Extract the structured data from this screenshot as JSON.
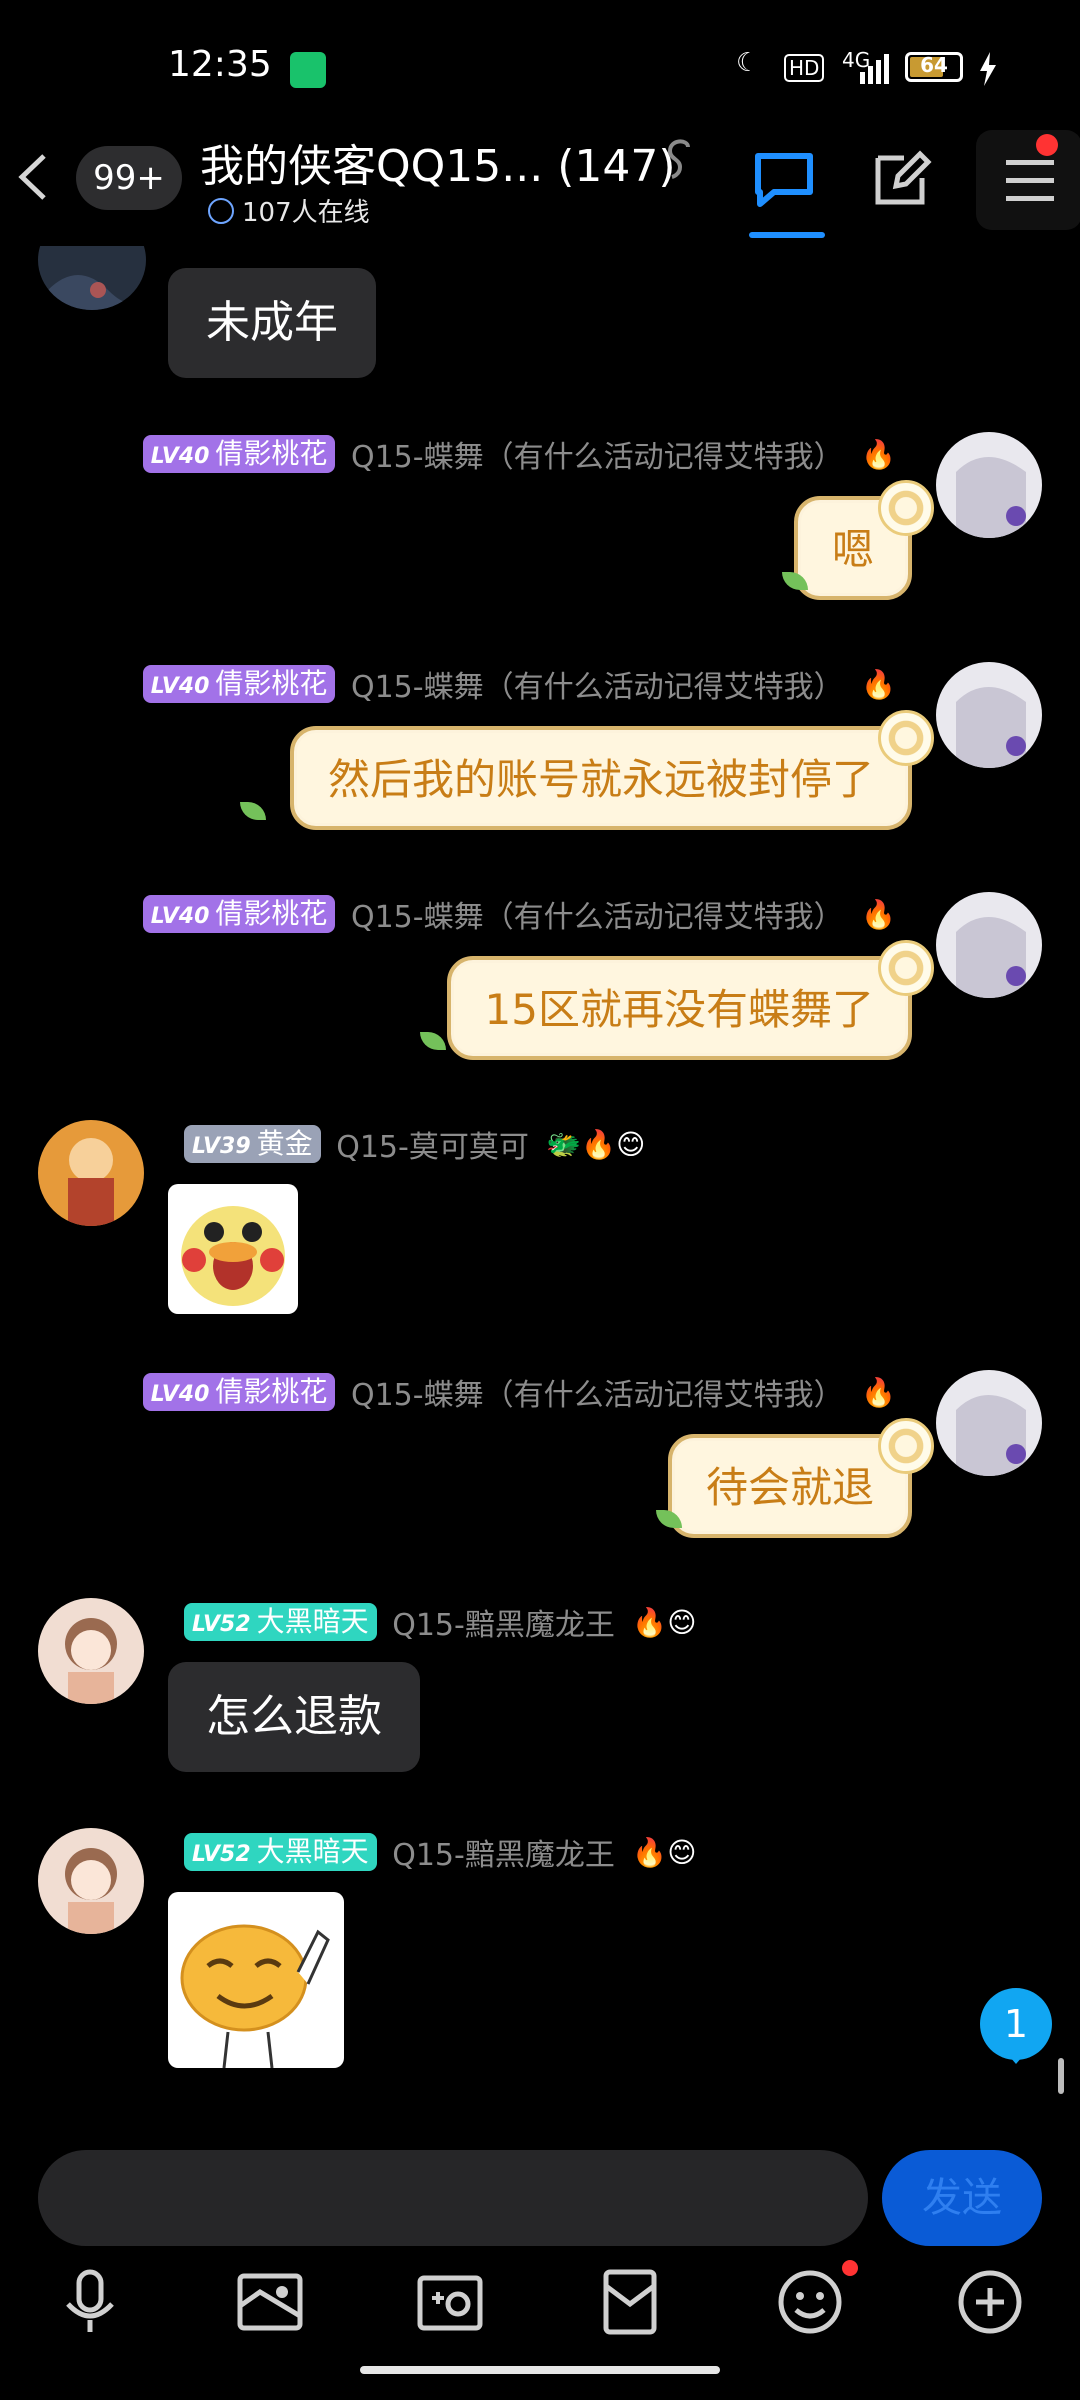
{
  "status_bar": {
    "time": "12:35",
    "network": "4G",
    "hd": "HD",
    "battery": "64",
    "battery_level": 0.64
  },
  "header": {
    "back_badge": "99+",
    "title": "我的侠客QQ15...  (147)",
    "online": "107人在线"
  },
  "messages": [
    {
      "type": "text",
      "side": "left",
      "text": "未成年"
    },
    {
      "type": "text",
      "side": "right",
      "level": "LV40",
      "title": "倩影桃花",
      "nick": "Q15-蝶舞（有什么活动记得艾特我）",
      "emoji": "🔥",
      "text": "嗯"
    },
    {
      "type": "text",
      "side": "right",
      "level": "LV40",
      "title": "倩影桃花",
      "nick": "Q15-蝶舞（有什么活动记得艾特我）",
      "emoji": "🔥",
      "text": "然后我的账号就永远被封停了"
    },
    {
      "type": "text",
      "side": "right",
      "level": "LV40",
      "title": "倩影桃花",
      "nick": "Q15-蝶舞（有什么活动记得艾特我）",
      "emoji": "🔥",
      "text": "15区就再没有蝶舞了"
    },
    {
      "type": "sticker",
      "side": "left",
      "level": "LV39",
      "title": "黄金",
      "nick": "Q15-莫可莫可",
      "emoji": "🐲🔥😊"
    },
    {
      "type": "text",
      "side": "right",
      "level": "LV40",
      "title": "倩影桃花",
      "nick": "Q15-蝶舞（有什么活动记得艾特我）",
      "emoji": "🔥",
      "text": "待会就退"
    },
    {
      "type": "text",
      "side": "left",
      "level": "LV52",
      "title": "大黑暗天",
      "nick": "Q15-黯黑魔龙王",
      "emoji": "🔥😊",
      "text": "怎么退款"
    },
    {
      "type": "sticker",
      "side": "left",
      "level": "LV52",
      "title": "大黑暗天",
      "nick": "Q15-黯黑魔龙王",
      "emoji": "🔥😊"
    }
  ],
  "unread_count": "1",
  "composer": {
    "placeholder": "",
    "send_label": "发送"
  },
  "colors": {
    "accent": "#1f8fff",
    "cream_bubble": "#fff6df",
    "cream_text": "#c87d16",
    "badge_purple": "#a272e8",
    "badge_teal": "#2fd6c0",
    "badge_silver": "#9aa2b6"
  }
}
